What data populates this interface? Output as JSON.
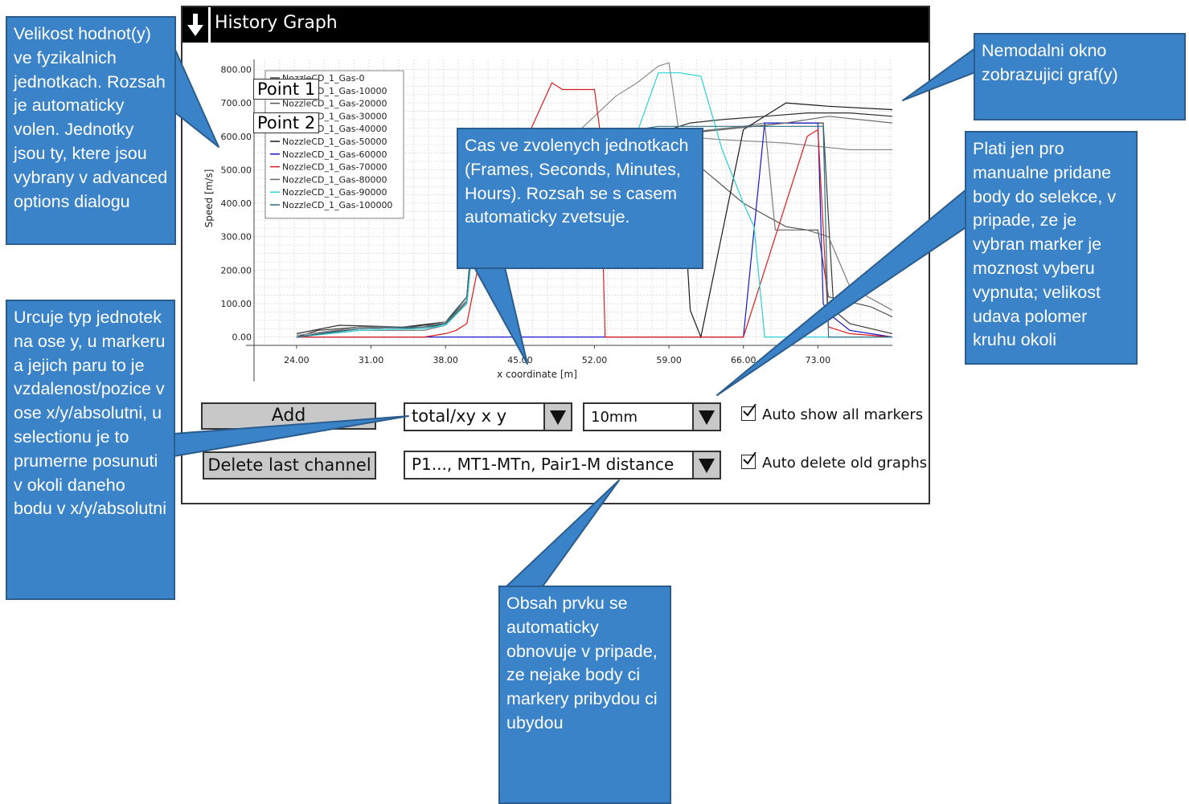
{
  "window": {
    "title": "History Graph"
  },
  "chart_data": {
    "type": "line",
    "xlabel": "x coordinate [m]",
    "ylabel": "Speed [m/s]",
    "xlim": [
      20,
      80
    ],
    "ylim": [
      -25,
      830
    ],
    "x_ticks": [
      "24.00",
      "31.00",
      "38.00",
      "45.00",
      "52.00",
      "59.00",
      "66.00",
      "73.00"
    ],
    "y_ticks": [
      "0.00",
      "100.00",
      "200.00",
      "300.00",
      "400.00",
      "500.00",
      "600.00",
      "700.00",
      "800.00"
    ],
    "legend_position": "top-left",
    "series": [
      {
        "name": "NozzleCD_1_Gas-0",
        "color": "#3a3a3a",
        "x": [
          24,
          26,
          30,
          34,
          38,
          40,
          41,
          42,
          44,
          50,
          58,
          64,
          70,
          73.5,
          74,
          74.5,
          76,
          80
        ],
        "y": [
          0,
          20,
          30,
          30,
          40,
          100,
          450,
          580,
          600,
          600,
          600,
          620,
          640,
          640,
          350,
          80,
          40,
          10
        ]
      },
      {
        "name": "NozzleCD_1_Gas-10000",
        "color": "#2e2e2e",
        "x": [
          24,
          28,
          34,
          38,
          40,
          41,
          42,
          45,
          52,
          58,
          61,
          64,
          68,
          72,
          76,
          80
        ],
        "y": [
          10,
          35,
          30,
          45,
          120,
          500,
          590,
          600,
          600,
          610,
          640,
          650,
          660,
          670,
          670,
          660
        ]
      },
      {
        "name": "NozzleCD_1_Gas-20000",
        "color": "#555555",
        "x": [
          24,
          30,
          36,
          38,
          40,
          41,
          42,
          46,
          54,
          60,
          66,
          70,
          72,
          73,
          74,
          78,
          80
        ],
        "y": [
          0,
          30,
          25,
          40,
          110,
          420,
          580,
          595,
          600,
          560,
          400,
          330,
          320,
          320,
          120,
          90,
          60
        ]
      },
      {
        "name": "NozzleCD_1_Gas-30000",
        "color": "#777777",
        "x": [
          24,
          30,
          36,
          38,
          40,
          41,
          42,
          46,
          54,
          60,
          66,
          68,
          69,
          72,
          74,
          76,
          80
        ],
        "y": [
          0,
          20,
          20,
          35,
          100,
          430,
          560,
          580,
          600,
          610,
          630,
          640,
          320,
          320,
          300,
          150,
          80
        ]
      },
      {
        "name": "NozzleCD_1_Gas-40000",
        "color": "#8a8a8a",
        "x": [
          24,
          30,
          36,
          38,
          40,
          41,
          42,
          46,
          50,
          54,
          56,
          58,
          59,
          60,
          64,
          70,
          76,
          80
        ],
        "y": [
          5,
          30,
          30,
          45,
          110,
          450,
          580,
          590,
          600,
          720,
          760,
          810,
          820,
          600,
          590,
          580,
          560,
          560
        ]
      },
      {
        "name": "NozzleCD_1_Gas-50000",
        "color": "#1a1a1a",
        "x": [
          24,
          30,
          36,
          38,
          40,
          41,
          42,
          46,
          52,
          58,
          60,
          61,
          62,
          66,
          70,
          74,
          80
        ],
        "y": [
          0,
          25,
          30,
          40,
          120,
          480,
          590,
          600,
          600,
          610,
          620,
          80,
          0,
          620,
          700,
          690,
          680
        ]
      },
      {
        "name": "NozzleCD_1_Gas-60000",
        "color": "#1515cc",
        "x": [
          24,
          30,
          38,
          40,
          41,
          42,
          50,
          60,
          66,
          68,
          68.5,
          73,
          73.5,
          74,
          76,
          80
        ],
        "y": [
          0,
          0,
          0,
          0,
          0,
          0,
          0,
          0,
          0,
          640,
          640,
          640,
          100,
          70,
          20,
          0
        ]
      },
      {
        "name": "NozzleCD_1_Gas-70000",
        "color": "#dd1a1a",
        "x": [
          24,
          30,
          36,
          38,
          39,
          40,
          41,
          42,
          44,
          46,
          48,
          49,
          52,
          52.5,
          53,
          60,
          66,
          72,
          73,
          74,
          76,
          80
        ],
        "y": [
          0,
          0,
          0,
          10,
          20,
          40,
          200,
          500,
          560,
          620,
          760,
          740,
          740,
          620,
          0,
          0,
          0,
          600,
          620,
          30,
          10,
          0
        ]
      },
      {
        "name": "NozzleCD_1_Gas-80000",
        "color": "#6a6a6a",
        "x": [
          24,
          30,
          36,
          38,
          40,
          41,
          42,
          46,
          52,
          56,
          60,
          64,
          70,
          74,
          80
        ],
        "y": [
          0,
          25,
          30,
          40,
          105,
          440,
          570,
          590,
          600,
          600,
          610,
          620,
          640,
          660,
          640
        ]
      },
      {
        "name": "NozzleCD_1_Gas-90000",
        "color": "#29d0d8",
        "x": [
          24,
          30,
          36,
          38,
          40,
          41,
          42,
          46,
          52,
          56,
          58,
          60,
          62,
          64,
          66,
          67,
          68,
          70,
          74,
          80
        ],
        "y": [
          0,
          20,
          25,
          35,
          100,
          440,
          580,
          590,
          600,
          610,
          790,
          790,
          780,
          560,
          400,
          330,
          0,
          0,
          0,
          0
        ]
      },
      {
        "name": "NozzleCD_1_Gas-100000",
        "color": "#2d6e83",
        "x": [
          24,
          30,
          36,
          38,
          40,
          41,
          42,
          46,
          52,
          56,
          58,
          64,
          70,
          72,
          73.5,
          74,
          76,
          80
        ],
        "y": [
          0,
          25,
          30,
          40,
          120,
          460,
          590,
          600,
          600,
          620,
          630,
          630,
          630,
          630,
          630,
          0,
          0,
          0
        ]
      }
    ],
    "markers": [
      "Point 1",
      "Point 2"
    ]
  },
  "controls": {
    "add_label": "Add",
    "delete_label": "Delete last channel",
    "unit_select": "total/xy x y",
    "size_select": "10mm",
    "target_select": "P1..., MT1-MTn, Pair1-M distance",
    "auto_show": "Auto show all markers",
    "auto_delete": "Auto delete old graphs"
  },
  "callouts": {
    "values": "Velikost hodnot(y) ve fyzikalnich jednotkach. Rozsah je automaticky volen. Jednotky jsou ty, ktere jsou vybrany v advanced options dialogu",
    "window": "Nemodalni okno zobrazujici graf(y)",
    "time": "Cas ve zvolenych jednotkach (Frames, Seconds, Minutes, Hours). Rozsah se s casem automaticky zvetsuje.",
    "manual": "Plati jen pro manualne pridane body do selekce, v pripade, ze je vybran marker je moznost vyberu vypnuta; velikost udava polomer kruhu okoli",
    "units": "Urcuje typ jednotek na ose y, u markeru a jejich paru to je vzdalenost/pozice v ose x/y/absolutni, u selectionu je to prumerne posunuti v okoli daneho bodu v x/y/absolutni",
    "content": "Obsah prvku se automaticky obnovuje v pripade, ze nejake body ci markery pribydou ci ubydou"
  },
  "colors": {
    "callout_fill": "#3b83c8",
    "callout_border": "#2a5d8e",
    "titlebar": "#000000"
  }
}
